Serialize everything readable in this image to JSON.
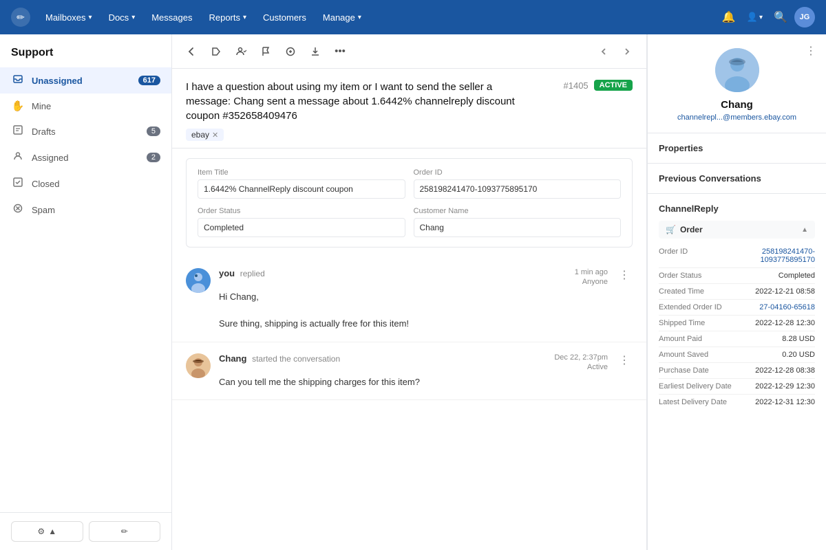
{
  "nav": {
    "logo_text": "✏",
    "items": [
      {
        "label": "Mailboxes",
        "has_dropdown": true
      },
      {
        "label": "Docs",
        "has_dropdown": true
      },
      {
        "label": "Messages",
        "has_dropdown": false
      },
      {
        "label": "Reports",
        "has_dropdown": true
      },
      {
        "label": "Customers",
        "has_dropdown": false
      },
      {
        "label": "Manage",
        "has_dropdown": true
      }
    ],
    "user_initials": "JG"
  },
  "sidebar": {
    "title": "Support",
    "items": [
      {
        "id": "unassigned",
        "label": "Unassigned",
        "count": "617",
        "active": true,
        "icon": "📥"
      },
      {
        "id": "mine",
        "label": "Mine",
        "count": "",
        "active": false,
        "icon": "✋"
      },
      {
        "id": "drafts",
        "label": "Drafts",
        "count": "5",
        "active": false,
        "icon": "📄"
      },
      {
        "id": "assigned",
        "label": "Assigned",
        "count": "2",
        "active": false,
        "icon": "👤"
      },
      {
        "id": "closed",
        "label": "Closed",
        "count": "",
        "active": false,
        "icon": "🗂"
      },
      {
        "id": "spam",
        "label": "Spam",
        "count": "",
        "active": false,
        "icon": "🚫"
      }
    ],
    "bottom_btn1_label": "⚙ ▲",
    "bottom_btn2_label": "✏"
  },
  "conversation": {
    "subject": "I have a question about using my item or I want to send the seller a message: Chang sent a message about 1.6442% channelreply discount coupon #352658409476",
    "id": "#1405",
    "status": "ACTIVE",
    "tags": [
      {
        "label": "ebay"
      }
    ],
    "order": {
      "item_title_label": "Item Title",
      "item_title_value": "1.6442% ChannelReply discount coupon",
      "order_id_label": "Order ID",
      "order_id_value": "258198241470-1093775895170",
      "order_status_label": "Order Status",
      "order_status_value": "Completed",
      "customer_name_label": "Customer Name",
      "customer_name_value": "Chang"
    },
    "messages": [
      {
        "sender": "you",
        "action": "replied",
        "time": "1 min ago",
        "assignee": "Anyone",
        "lines": [
          "Hi Chang,",
          "",
          "Sure thing, shipping is actually free for this item!"
        ],
        "avatar_type": "you"
      },
      {
        "sender": "Chang",
        "action": "started the conversation",
        "time": "Dec 22, 2:37pm",
        "assignee": "Active",
        "lines": [
          "Can you tell me the shipping charges for this item?"
        ],
        "avatar_type": "chang"
      }
    ]
  },
  "right_panel": {
    "contact": {
      "name": "Chang",
      "email": "channelrepl...@members.ebay.com"
    },
    "sections": [
      {
        "id": "properties",
        "label": "Properties"
      },
      {
        "id": "previous_conversations",
        "label": "Previous Conversations"
      },
      {
        "id": "channelreply",
        "label": "ChannelReply"
      }
    ],
    "order_details": {
      "subsection_title": "Order",
      "rows": [
        {
          "label": "Order ID",
          "value": "258198241470-1093775895170",
          "link": true
        },
        {
          "label": "Order Status",
          "value": "Completed",
          "link": false
        },
        {
          "label": "Created Time",
          "value": "2022-12-21 08:58",
          "link": false
        },
        {
          "label": "Extended Order ID",
          "value": "27-04160-65618",
          "link": true
        },
        {
          "label": "Shipped Time",
          "value": "2022-12-28 12:30",
          "link": false
        },
        {
          "label": "Amount Paid",
          "value": "8.28 USD",
          "link": false
        },
        {
          "label": "Amount Saved",
          "value": "0.20 USD",
          "link": false
        },
        {
          "label": "Purchase Date",
          "value": "2022-12-28 08:38",
          "link": false
        },
        {
          "label": "Earliest Delivery Date",
          "value": "2022-12-29 12:30",
          "link": false
        },
        {
          "label": "Latest Delivery Date",
          "value": "2022-12-31 12:30",
          "link": false
        }
      ]
    }
  }
}
